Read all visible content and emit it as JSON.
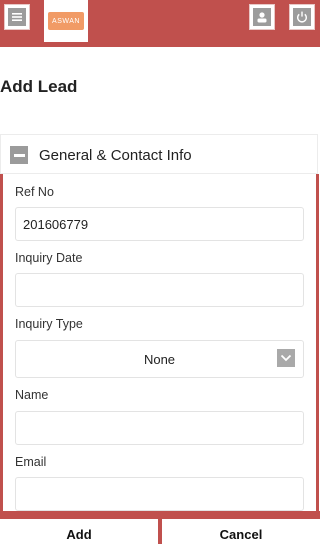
{
  "header": {
    "logo_text": "ASWAN",
    "menu_icon": "hamburger-icon",
    "user_icon": "user-icon",
    "power_icon": "power-icon",
    "accent_color": "#c0504d"
  },
  "page": {
    "title": "Add Lead"
  },
  "section": {
    "title": "General & Contact Info",
    "toggle_icon": "minus-icon"
  },
  "form": {
    "ref_no": {
      "label": "Ref No",
      "value": "201606779"
    },
    "inquiry_date": {
      "label": "Inquiry Date",
      "value": ""
    },
    "inquiry_type": {
      "label": "Inquiry Type",
      "value": "None"
    },
    "name": {
      "label": "Name",
      "value": ""
    },
    "email": {
      "label": "Email",
      "value": ""
    }
  },
  "footer": {
    "add_label": "Add",
    "cancel_label": "Cancel"
  }
}
